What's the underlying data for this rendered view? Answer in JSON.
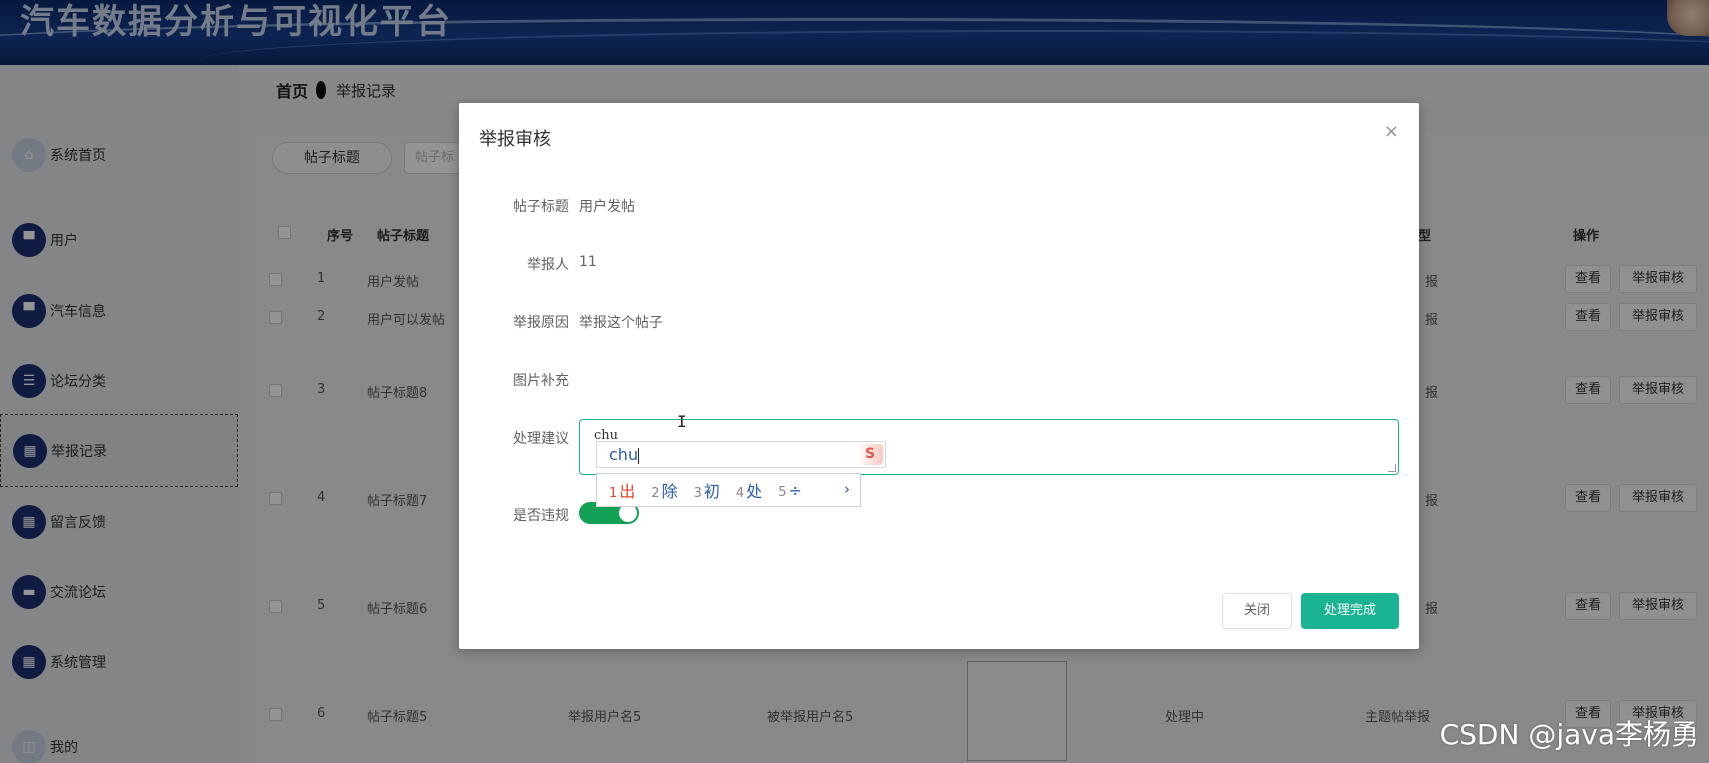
{
  "app": {
    "title": "汽车数据分析与可视化平台"
  },
  "sidebar": {
    "items": [
      {
        "label": "系统首页",
        "icon": "home-icon"
      },
      {
        "label": "用户",
        "icon": "monitor-icon"
      },
      {
        "label": "汽车信息",
        "icon": "monitor-icon"
      },
      {
        "label": "论坛分类",
        "icon": "list-icon"
      },
      {
        "label": "举报记录",
        "icon": "grid-icon",
        "active": true
      },
      {
        "label": "留言反馈",
        "icon": "grid-icon"
      },
      {
        "label": "交流论坛",
        "icon": "chat-icon"
      },
      {
        "label": "系统管理",
        "icon": "grid-icon"
      },
      {
        "label": "我的",
        "icon": "user-icon"
      }
    ]
  },
  "breadcrumb": {
    "home": "首页",
    "current": "举报记录"
  },
  "search": {
    "label": "帖子标题",
    "placeholder": "帖子标"
  },
  "table": {
    "headers": {
      "index": "序号",
      "title": "帖子标题",
      "type": "型",
      "actions": "操作"
    },
    "rows": [
      {
        "index": "1",
        "title": "用户发帖",
        "type_tail": "报",
        "reporter": "",
        "reported": "",
        "status": ""
      },
      {
        "index": "2",
        "title": "用户可以发帖",
        "type_tail": "报",
        "reporter": "",
        "reported": "",
        "status": ""
      },
      {
        "index": "3",
        "title": "帖子标题8",
        "type_tail": "报",
        "reporter": "",
        "reported": "",
        "status": ""
      },
      {
        "index": "4",
        "title": "帖子标题7",
        "type_tail": "报",
        "reporter": "",
        "reported": "",
        "status": ""
      },
      {
        "index": "5",
        "title": "帖子标题6",
        "type_tail": "报",
        "reporter": "",
        "reported": "",
        "status": ""
      },
      {
        "index": "6",
        "title": "帖子标题5",
        "type_tail": "主题帖举报",
        "reporter": "举报用户名5",
        "reported": "被举报用户名5",
        "status": "处理中"
      }
    ],
    "view_label": "查看",
    "review_label": "举报审核"
  },
  "dialog": {
    "title": "举报审核",
    "close_icon": "×",
    "fields": {
      "post_title_label": "帖子标题",
      "post_title_value": "用户发帖",
      "reporter_label": "举报人",
      "reporter_value": "11",
      "reason_label": "举报原因",
      "reason_value": "举报这个帖子",
      "image_label": "图片补充",
      "suggestion_label": "处理建议",
      "suggestion_value": "chu",
      "violation_label": "是否违规",
      "violation_on": true
    },
    "close_button": "关闭",
    "done_button": "处理完成"
  },
  "ime": {
    "composition": "chu",
    "logo": "S",
    "candidates": [
      {
        "n": "1",
        "ch": "出"
      },
      {
        "n": "2",
        "ch": "除"
      },
      {
        "n": "3",
        "ch": "初"
      },
      {
        "n": "4",
        "ch": "处"
      },
      {
        "n": "5",
        "ch": "÷"
      }
    ],
    "next": "›"
  },
  "watermark": "CSDN @java李杨勇",
  "colors": {
    "accent": "#1ab394",
    "switch_on": "#13a155",
    "nav_icon": "#1b2f6e",
    "header": "#173f8f"
  }
}
